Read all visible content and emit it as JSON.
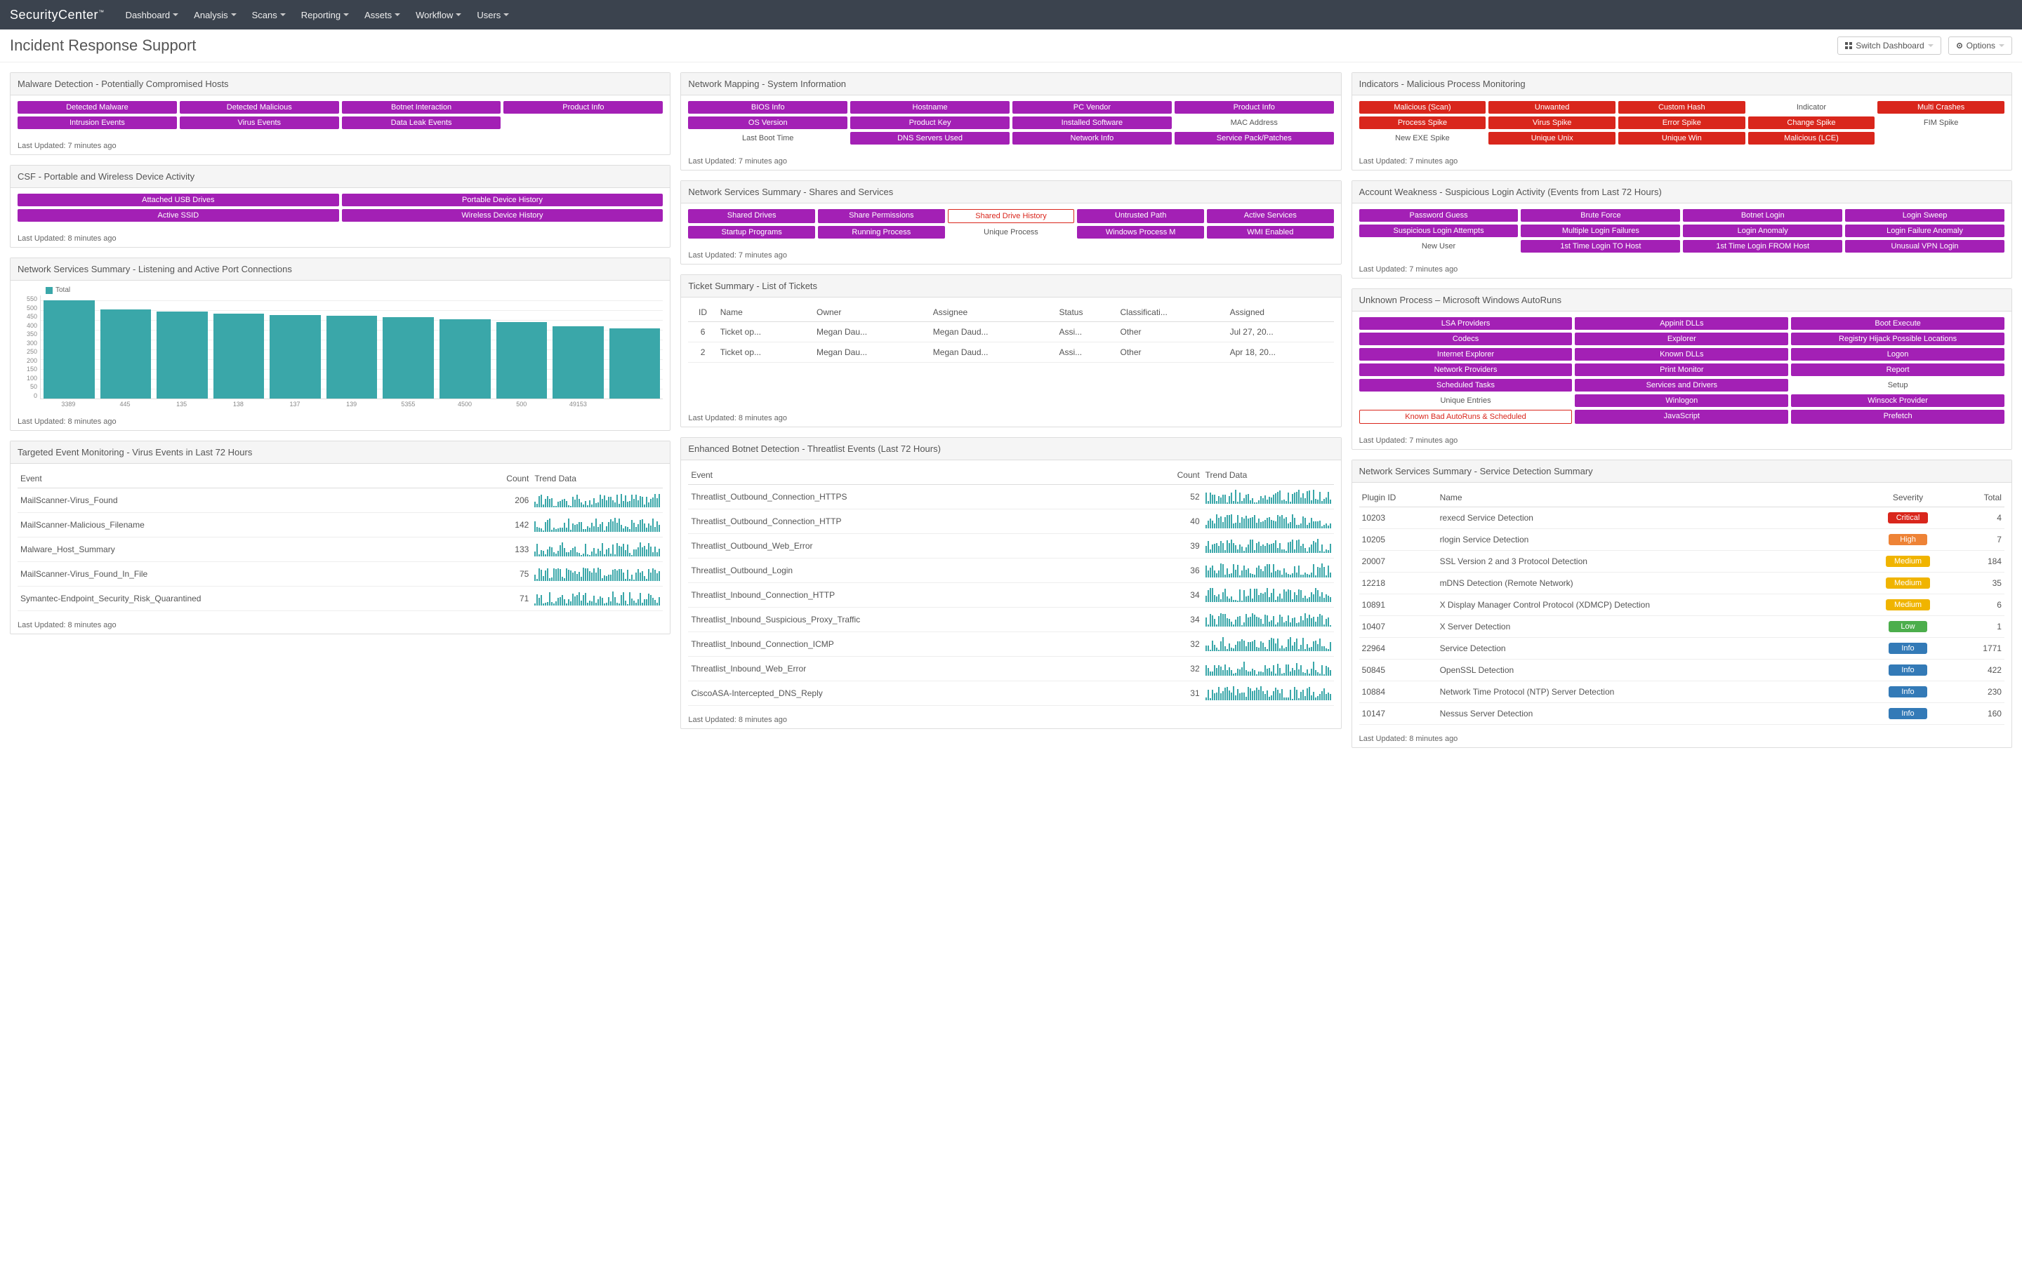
{
  "brand": "SecurityCenter",
  "nav": [
    "Dashboard",
    "Analysis",
    "Scans",
    "Reporting",
    "Assets",
    "Workflow",
    "Users"
  ],
  "page_title": "Incident Response Support",
  "btn_switch": "Switch Dashboard",
  "btn_options": "Options",
  "updated7": "Last Updated: 7 minutes ago",
  "updated8": "Last Updated: 8 minutes ago",
  "p_malware": {
    "title": "Malware Detection - Potentially Compromised Hosts",
    "tags": [
      {
        "t": "Detected Malware",
        "c": "purple"
      },
      {
        "t": "Detected Malicious",
        "c": "purple"
      },
      {
        "t": "Botnet Interaction",
        "c": "purple"
      },
      {
        "t": "Product Info",
        "c": "purple"
      },
      {
        "t": "Intrusion Events",
        "c": "purple"
      },
      {
        "t": "Virus Events",
        "c": "purple"
      },
      {
        "t": "Data Leak Events",
        "c": "purple"
      }
    ]
  },
  "p_csf": {
    "title": "CSF - Portable and Wireless Device Activity",
    "tags": [
      {
        "t": "Attached USB Drives",
        "c": "purple"
      },
      {
        "t": "Portable Device History",
        "c": "purple"
      },
      {
        "t": "Active SSID",
        "c": "purple"
      },
      {
        "t": "Wireless Device History",
        "c": "purple"
      }
    ]
  },
  "p_ports": {
    "title": "Network Services Summary - Listening and Active Port Connections",
    "legend": "Total",
    "chart_data": {
      "type": "bar",
      "title": "Network Services Summary - Listening and Active Port Connections",
      "ylabel": "Total",
      "ylim": [
        0,
        600
      ],
      "yticks": [
        0,
        50,
        100,
        150,
        200,
        250,
        300,
        350,
        400,
        450,
        500,
        550
      ],
      "categories": [
        "3389",
        "445",
        "135",
        "138",
        "137",
        "139",
        "5355",
        "4500",
        "500",
        "49153"
      ],
      "values": [
        570,
        520,
        505,
        495,
        485,
        480,
        475,
        460,
        445,
        420,
        410
      ]
    }
  },
  "p_virus": {
    "title": "Targeted Event Monitoring - Virus Events in Last 72 Hours",
    "cols": [
      "Event",
      "Count",
      "Trend Data"
    ],
    "rows": [
      {
        "e": "MailScanner-Virus_Found",
        "c": 206
      },
      {
        "e": "MailScanner-Malicious_Filename",
        "c": 142
      },
      {
        "e": "Malware_Host_Summary",
        "c": 133
      },
      {
        "e": "MailScanner-Virus_Found_In_File",
        "c": 75
      },
      {
        "e": "Symantec-Endpoint_Security_Risk_Quarantined",
        "c": 71
      }
    ]
  },
  "p_sysinfo": {
    "title": "Network Mapping - System Information",
    "tags": [
      {
        "t": "BIOS Info",
        "c": "purple"
      },
      {
        "t": "Hostname",
        "c": "purple"
      },
      {
        "t": "PC Vendor",
        "c": "purple"
      },
      {
        "t": "Product Info",
        "c": "purple"
      },
      {
        "t": "OS Version",
        "c": "purple"
      },
      {
        "t": "Product Key",
        "c": "purple"
      },
      {
        "t": "Installed Software",
        "c": "purple"
      },
      {
        "t": "MAC Address",
        "c": "white"
      },
      {
        "t": "Last Boot Time",
        "c": "white"
      },
      {
        "t": "DNS Servers Used",
        "c": "purple"
      },
      {
        "t": "Network Info",
        "c": "purple"
      },
      {
        "t": "Service Pack/Patches",
        "c": "purple"
      }
    ]
  },
  "p_shares": {
    "title": "Network Services Summary - Shares and Services",
    "tags": [
      {
        "t": "Shared Drives",
        "c": "purple"
      },
      {
        "t": "Share Permissions",
        "c": "purple"
      },
      {
        "t": "Shared Drive History",
        "c": "redborder"
      },
      {
        "t": "Untrusted Path",
        "c": "purple"
      },
      {
        "t": "Active Services",
        "c": "purple"
      },
      {
        "t": "Startup Programs",
        "c": "purple"
      },
      {
        "t": "Running Process",
        "c": "purple"
      },
      {
        "t": "Unique Process",
        "c": "white"
      },
      {
        "t": "Windows Process M",
        "c": "purple"
      },
      {
        "t": "WMI Enabled",
        "c": "purple"
      }
    ]
  },
  "p_tickets": {
    "title": "Ticket Summary - List of Tickets",
    "cols": [
      "ID",
      "Name",
      "Owner",
      "Assignee",
      "Status",
      "Classificati...",
      "Assigned"
    ],
    "rows": [
      {
        "id": 6,
        "name": "Ticket op...",
        "owner": "Megan Dau...",
        "assignee": "Megan Daud...",
        "status": "Assi...",
        "cls": "Other",
        "assigned": "Jul 27, 20..."
      },
      {
        "id": 2,
        "name": "Ticket op...",
        "owner": "Megan Dau...",
        "assignee": "Megan Daud...",
        "status": "Assi...",
        "cls": "Other",
        "assigned": "Apr 18, 20..."
      }
    ]
  },
  "p_botnet": {
    "title": "Enhanced Botnet Detection - Threatlist Events (Last 72 Hours)",
    "cols": [
      "Event",
      "Count",
      "Trend Data"
    ],
    "rows": [
      {
        "e": "Threatlist_Outbound_Connection_HTTPS",
        "c": 52
      },
      {
        "e": "Threatlist_Outbound_Connection_HTTP",
        "c": 40
      },
      {
        "e": "Threatlist_Outbound_Web_Error",
        "c": 39
      },
      {
        "e": "Threatlist_Outbound_Login",
        "c": 36
      },
      {
        "e": "Threatlist_Inbound_Connection_HTTP",
        "c": 34
      },
      {
        "e": "Threatlist_Inbound_Suspicious_Proxy_Traffic",
        "c": 34
      },
      {
        "e": "Threatlist_Inbound_Connection_ICMP",
        "c": 32
      },
      {
        "e": "Threatlist_Inbound_Web_Error",
        "c": 32
      },
      {
        "e": "CiscoASA-Intercepted_DNS_Reply",
        "c": 31
      }
    ]
  },
  "p_indicators": {
    "title": "Indicators - Malicious Process Monitoring",
    "tags": [
      {
        "t": "Malicious (Scan)",
        "c": "red"
      },
      {
        "t": "Unwanted",
        "c": "red"
      },
      {
        "t": "Custom Hash",
        "c": "red"
      },
      {
        "t": "Indicator",
        "c": "white"
      },
      {
        "t": "Multi Crashes",
        "c": "red"
      },
      {
        "t": "Process Spike",
        "c": "red"
      },
      {
        "t": "Virus Spike",
        "c": "red"
      },
      {
        "t": "Error Spike",
        "c": "red"
      },
      {
        "t": "Change Spike",
        "c": "red"
      },
      {
        "t": "FIM Spike",
        "c": "white"
      },
      {
        "t": "New EXE Spike",
        "c": "white"
      },
      {
        "t": "Unique Unix",
        "c": "red"
      },
      {
        "t": "Unique Win",
        "c": "red"
      },
      {
        "t": "Malicious (LCE)",
        "c": "red"
      }
    ]
  },
  "p_account": {
    "title": "Account Weakness - Suspicious Login Activity (Events from Last 72 Hours)",
    "tags": [
      {
        "t": "Password Guess",
        "c": "purple"
      },
      {
        "t": "Brute Force",
        "c": "purple"
      },
      {
        "t": "Botnet Login",
        "c": "purple"
      },
      {
        "t": "Login Sweep",
        "c": "purple"
      },
      {
        "t": "Suspicious Login Attempts",
        "c": "purple"
      },
      {
        "t": "Multiple Login Failures",
        "c": "purple"
      },
      {
        "t": "Login Anomaly",
        "c": "purple"
      },
      {
        "t": "Login Failure Anomaly",
        "c": "purple"
      },
      {
        "t": "New User",
        "c": "white"
      },
      {
        "t": "1st Time Login TO Host",
        "c": "purple"
      },
      {
        "t": "1st Time Login FROM Host",
        "c": "purple"
      },
      {
        "t": "Unusual VPN Login",
        "c": "purple"
      }
    ]
  },
  "p_autoruns": {
    "title": "Unknown Process – Microsoft Windows AutoRuns",
    "tags": [
      {
        "t": "LSA Providers",
        "c": "purple"
      },
      {
        "t": "Appinit DLLs",
        "c": "purple"
      },
      {
        "t": "Boot Execute",
        "c": "purple"
      },
      {
        "t": "Codecs",
        "c": "purple"
      },
      {
        "t": "Explorer",
        "c": "purple"
      },
      {
        "t": "Registry Hijack Possible Locations",
        "c": "purple"
      },
      {
        "t": "Internet Explorer",
        "c": "purple"
      },
      {
        "t": "Known DLLs",
        "c": "purple"
      },
      {
        "t": "Logon",
        "c": "purple"
      },
      {
        "t": "Network Providers",
        "c": "purple"
      },
      {
        "t": "Print Monitor",
        "c": "purple"
      },
      {
        "t": "Report",
        "c": "purple"
      },
      {
        "t": "Scheduled Tasks",
        "c": "purple"
      },
      {
        "t": "Services and Drivers",
        "c": "purple"
      },
      {
        "t": "Setup",
        "c": "white"
      },
      {
        "t": "Unique Entries",
        "c": "white"
      },
      {
        "t": "Winlogon",
        "c": "purple"
      },
      {
        "t": "Winsock Provider",
        "c": "purple"
      },
      {
        "t": "Known Bad AutoRuns & Scheduled",
        "c": "redborder"
      },
      {
        "t": "JavaScript",
        "c": "purple"
      },
      {
        "t": "Prefetch",
        "c": "purple"
      }
    ]
  },
  "p_service": {
    "title": "Network Services Summary - Service Detection Summary",
    "cols": [
      "Plugin ID",
      "Name",
      "Severity",
      "Total"
    ],
    "rows": [
      {
        "id": 10203,
        "name": "rexecd Service Detection",
        "sev": "Critical",
        "cls": "sev-critical",
        "total": 4
      },
      {
        "id": 10205,
        "name": "rlogin Service Detection",
        "sev": "High",
        "cls": "sev-high",
        "total": 7
      },
      {
        "id": 20007,
        "name": "SSL Version 2 and 3 Protocol Detection",
        "sev": "Medium",
        "cls": "sev-medium",
        "total": 184
      },
      {
        "id": 12218,
        "name": "mDNS Detection (Remote Network)",
        "sev": "Medium",
        "cls": "sev-medium",
        "total": 35
      },
      {
        "id": 10891,
        "name": "X Display Manager Control Protocol (XDMCP) Detection",
        "sev": "Medium",
        "cls": "sev-medium",
        "total": 6
      },
      {
        "id": 10407,
        "name": "X Server Detection",
        "sev": "Low",
        "cls": "sev-low",
        "total": 1
      },
      {
        "id": 22964,
        "name": "Service Detection",
        "sev": "Info",
        "cls": "sev-info",
        "total": 1771
      },
      {
        "id": 50845,
        "name": "OpenSSL Detection",
        "sev": "Info",
        "cls": "sev-info",
        "total": 422
      },
      {
        "id": 10884,
        "name": "Network Time Protocol (NTP) Server Detection",
        "sev": "Info",
        "cls": "sev-info",
        "total": 230
      },
      {
        "id": 10147,
        "name": "Nessus Server Detection",
        "sev": "Info",
        "cls": "sev-info",
        "total": 160
      }
    ]
  }
}
